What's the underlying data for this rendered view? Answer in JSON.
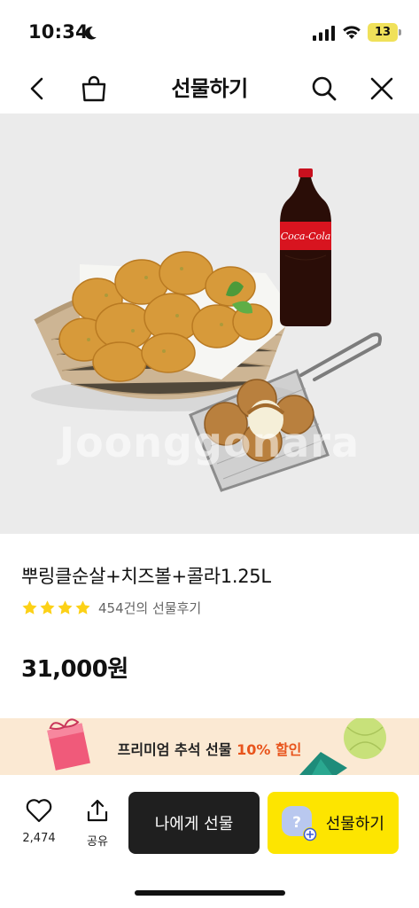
{
  "status_bar": {
    "time": "10:34",
    "battery": "13"
  },
  "nav": {
    "title": "선물하기"
  },
  "product": {
    "image_watermark": "Joonggonara",
    "name": "뿌링클순살+치즈볼+콜라1.25L",
    "rating_stars": 4,
    "review_count": "454건의 선물후기",
    "price": "31,000원",
    "bottle_label": "Coca-Cola"
  },
  "promo": {
    "text_before": "프리미엄 추석 선물",
    "highlight": "10% 할인"
  },
  "bottom": {
    "like_count": "2,474",
    "share_label": "공유",
    "self_gift_label": "나에게 선물",
    "gift_label": "선물하기",
    "gift_avatar_mark": "?"
  },
  "colors": {
    "accent_yellow": "#fde500",
    "star_yellow": "#fcd117",
    "promo_bg": "#fbe9d3",
    "promo_highlight": "#e8541c",
    "dark_button": "#1f1f1f"
  }
}
